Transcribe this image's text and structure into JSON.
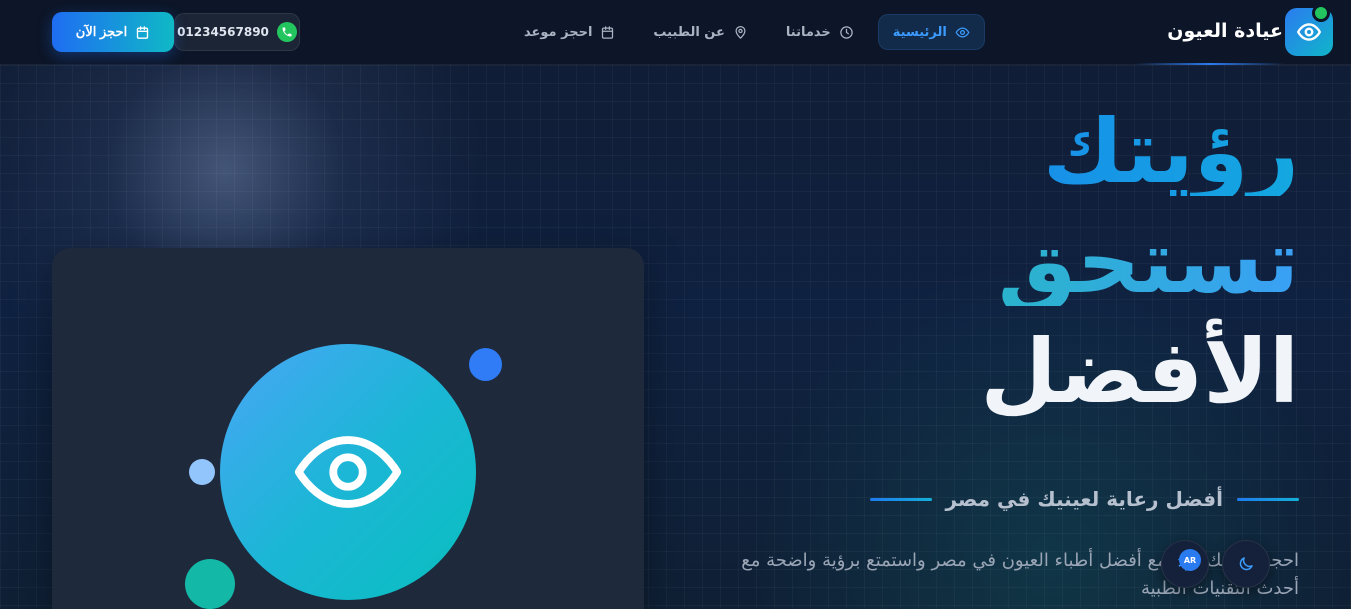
{
  "brand": {
    "name": "عيادة العيون",
    "icon": "eye-icon",
    "status_color": "#22c55e"
  },
  "nav": {
    "items": [
      {
        "label": "الرئيسية",
        "icon": "eye-icon",
        "active": true
      },
      {
        "label": "خدماتنا",
        "icon": "clock-icon",
        "active": false
      },
      {
        "label": "عن الطبيب",
        "icon": "location-pin-icon",
        "active": false
      },
      {
        "label": "احجز موعد",
        "icon": "calendar-icon",
        "active": false
      }
    ],
    "phone": "01234567890",
    "phone_icon": "phone-icon",
    "book_label": "احجز الآن",
    "book_icon": "calendar-icon"
  },
  "hero": {
    "line1": "رؤيتك",
    "line2": "تستحق",
    "line3": "الأفضل",
    "subtitle": "أفضل رعاية لعينيك في مصر",
    "description": "احجز كشفك الآن مع أفضل أطباء العيون في مصر واستمتع برؤية واضحة مع أحدث التقنيات الطبية"
  },
  "floating": {
    "language_badge": "AR",
    "language_icon": "translate-icon",
    "theme_icon": "moon-icon"
  },
  "colors": {
    "accent_blue": "#2b7bf0",
    "accent_teal": "#14b8a6",
    "background": "#0f1a30",
    "card": "#1e293b"
  }
}
